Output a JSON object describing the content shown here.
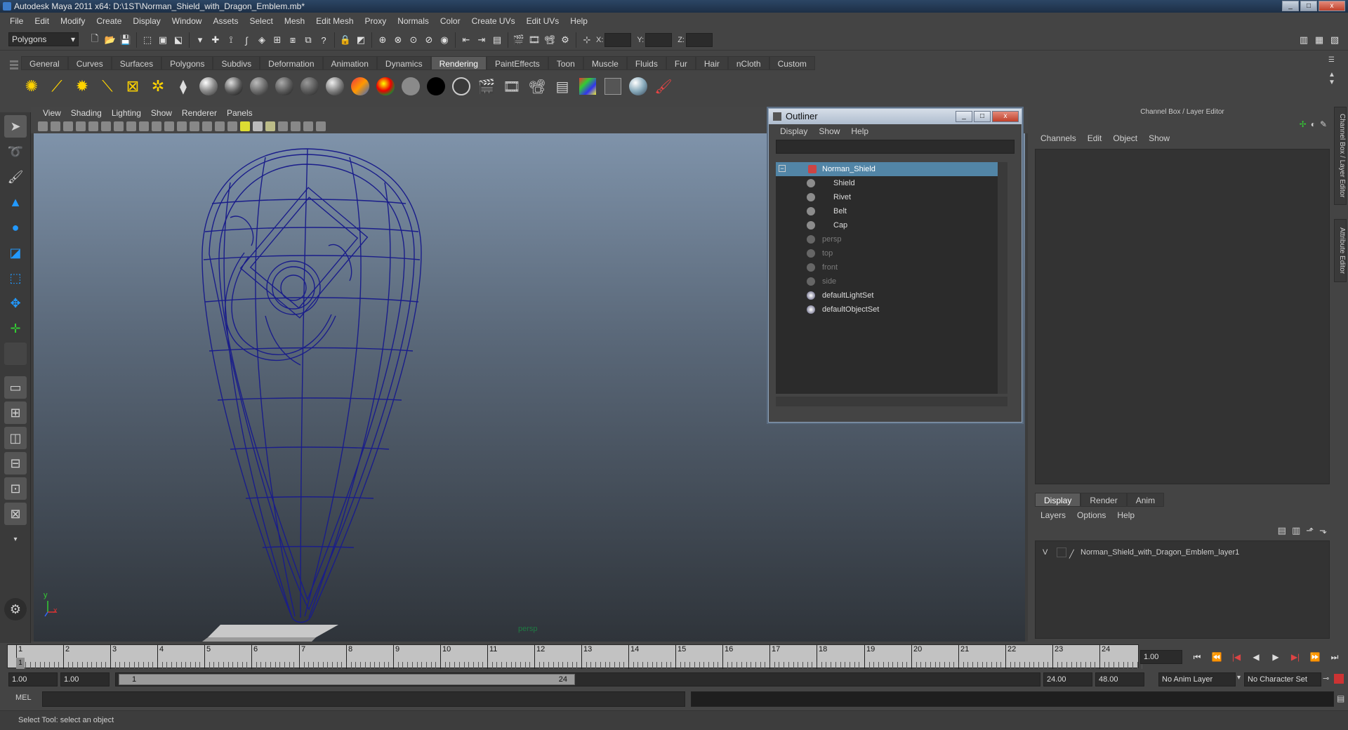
{
  "window": {
    "title": "Autodesk Maya 2011 x64: D:\\1ST\\Norman_Shield_with_Dragon_Emblem.mb*",
    "min": "_",
    "max": "□",
    "close": "x"
  },
  "menubar": [
    "File",
    "Edit",
    "Modify",
    "Create",
    "Display",
    "Window",
    "Assets",
    "Select",
    "Mesh",
    "Edit Mesh",
    "Proxy",
    "Normals",
    "Color",
    "Create UVs",
    "Edit UVs",
    "Help"
  ],
  "statusline": {
    "mode": "Polygons",
    "x_label": "X:",
    "y_label": "Y:",
    "z_label": "Z:"
  },
  "shelf": {
    "tabs": [
      "General",
      "Curves",
      "Surfaces",
      "Polygons",
      "Subdivs",
      "Deformation",
      "Animation",
      "Dynamics",
      "Rendering",
      "PaintEffects",
      "Toon",
      "Muscle",
      "Fluids",
      "Fur",
      "Hair",
      "nCloth",
      "Custom"
    ],
    "active": "Rendering"
  },
  "viewport": {
    "menu": [
      "View",
      "Shading",
      "Lighting",
      "Show",
      "Renderer",
      "Panels"
    ],
    "camera_label": "persp",
    "axis_y": "y",
    "axis_x": "x"
  },
  "outliner": {
    "title": "Outliner",
    "menu": [
      "Display",
      "Show",
      "Help"
    ],
    "items": [
      {
        "label": "Norman_Shield",
        "selected": true,
        "level": 0,
        "dim": false
      },
      {
        "label": "Shield",
        "level": 1,
        "dim": false
      },
      {
        "label": "Rivet",
        "level": 1,
        "dim": false
      },
      {
        "label": "Belt",
        "level": 1,
        "dim": false
      },
      {
        "label": "Cap",
        "level": 1,
        "dim": false
      },
      {
        "label": "persp",
        "level": 0,
        "dim": true
      },
      {
        "label": "top",
        "level": 0,
        "dim": true
      },
      {
        "label": "front",
        "level": 0,
        "dim": true
      },
      {
        "label": "side",
        "level": 0,
        "dim": true
      },
      {
        "label": "defaultLightSet",
        "level": 0,
        "dim": false
      },
      {
        "label": "defaultObjectSet",
        "level": 0,
        "dim": false
      }
    ]
  },
  "channelbox": {
    "title": "Channel Box / Layer Editor",
    "menu": [
      "Channels",
      "Edit",
      "Object",
      "Show"
    ]
  },
  "side_tabs": [
    "Channel Box / Layer Editor",
    "Attribute Editor"
  ],
  "layer_editor": {
    "tabs": [
      "Display",
      "Render",
      "Anim"
    ],
    "active": "Display",
    "menu": [
      "Layers",
      "Options",
      "Help"
    ],
    "layer_visible": "V",
    "layer_name": "Norman_Shield_with_Dragon_Emblem_layer1"
  },
  "timeline": {
    "ticks": [
      "1",
      "2",
      "3",
      "4",
      "5",
      "6",
      "7",
      "8",
      "9",
      "10",
      "11",
      "12",
      "13",
      "14",
      "15",
      "16",
      "17",
      "18",
      "19",
      "20",
      "21",
      "22",
      "23",
      "24"
    ],
    "current_frame": "1.00",
    "current_marker": "1"
  },
  "range": {
    "start": "1.00",
    "playback_start": "1.00",
    "range_start": "1",
    "range_end": "24",
    "playback_end": "24.00",
    "end": "48.00",
    "anim_layer": "No Anim Layer",
    "char_set": "No Character Set"
  },
  "command": {
    "label": "MEL"
  },
  "help_line": "Select Tool: select an object"
}
